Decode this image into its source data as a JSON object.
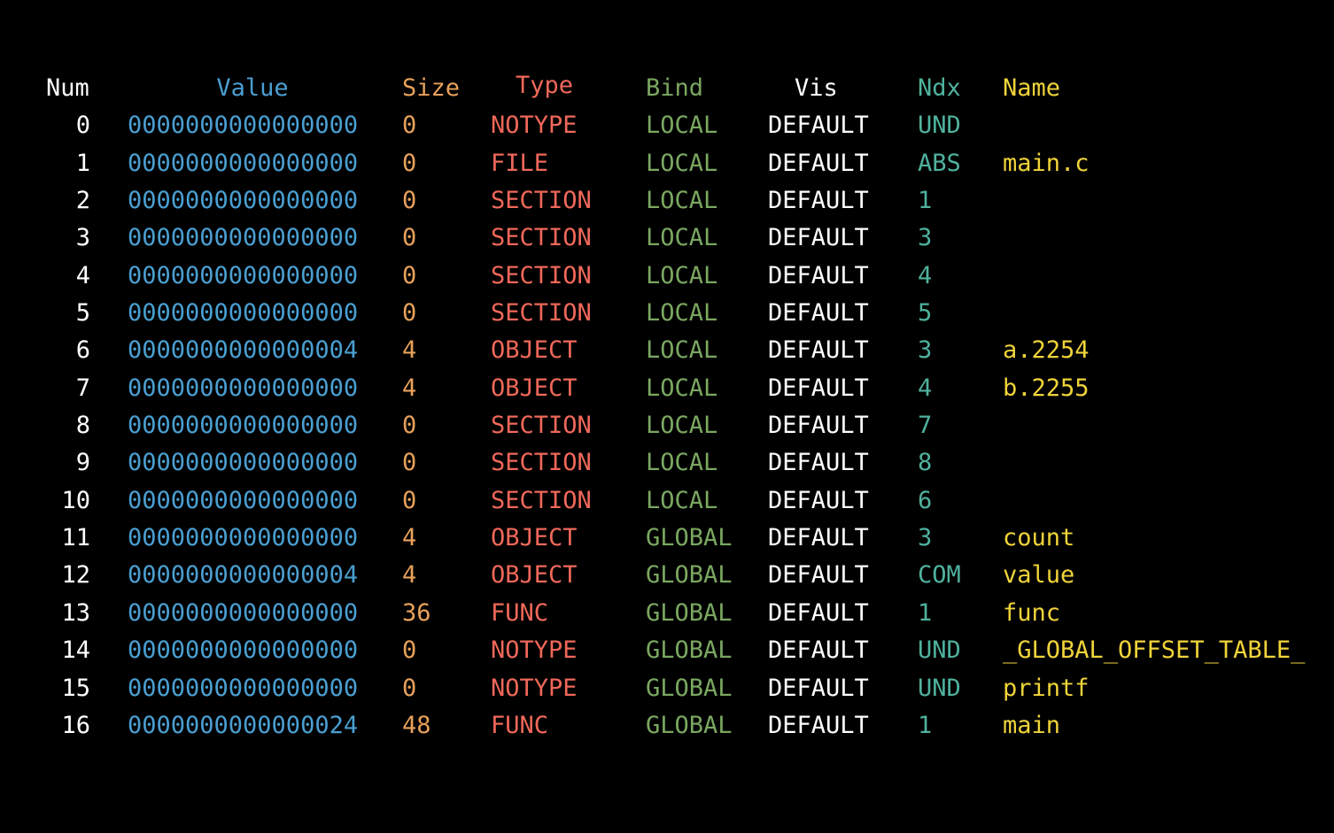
{
  "colors": {
    "background": "#000000",
    "num": "#ffffff",
    "value": "#4a9fd1",
    "size": "#e8a15a",
    "type": "#f0685a",
    "bind": "#7aa760",
    "vis": "#ffffff",
    "ndx": "#4fb29e",
    "name": "#f0d43a"
  },
  "headers": {
    "num": "Num",
    "value": "Value",
    "size": "Size",
    "type": "Type",
    "bind": "Bind",
    "vis": "Vis",
    "ndx": "Ndx",
    "name": "Name"
  },
  "rows": [
    {
      "num": "0",
      "value": "0000000000000000",
      "size": "0",
      "type": "NOTYPE",
      "bind": "LOCAL",
      "vis": "DEFAULT",
      "ndx": "UND",
      "name": ""
    },
    {
      "num": "1",
      "value": "0000000000000000",
      "size": "0",
      "type": "FILE",
      "bind": "LOCAL",
      "vis": "DEFAULT",
      "ndx": "ABS",
      "name": "main.c"
    },
    {
      "num": "2",
      "value": "0000000000000000",
      "size": "0",
      "type": "SECTION",
      "bind": "LOCAL",
      "vis": "DEFAULT",
      "ndx": "1",
      "name": ""
    },
    {
      "num": "3",
      "value": "0000000000000000",
      "size": "0",
      "type": "SECTION",
      "bind": "LOCAL",
      "vis": "DEFAULT",
      "ndx": "3",
      "name": ""
    },
    {
      "num": "4",
      "value": "0000000000000000",
      "size": "0",
      "type": "SECTION",
      "bind": "LOCAL",
      "vis": "DEFAULT",
      "ndx": "4",
      "name": ""
    },
    {
      "num": "5",
      "value": "0000000000000000",
      "size": "0",
      "type": "SECTION",
      "bind": "LOCAL",
      "vis": "DEFAULT",
      "ndx": "5",
      "name": ""
    },
    {
      "num": "6",
      "value": "0000000000000004",
      "size": "4",
      "type": "OBJECT",
      "bind": "LOCAL",
      "vis": "DEFAULT",
      "ndx": "3",
      "name": "a.2254"
    },
    {
      "num": "7",
      "value": "0000000000000000",
      "size": "4",
      "type": "OBJECT",
      "bind": "LOCAL",
      "vis": "DEFAULT",
      "ndx": "4",
      "name": "b.2255"
    },
    {
      "num": "8",
      "value": "0000000000000000",
      "size": "0",
      "type": "SECTION",
      "bind": "LOCAL",
      "vis": "DEFAULT",
      "ndx": "7",
      "name": ""
    },
    {
      "num": "9",
      "value": "0000000000000000",
      "size": "0",
      "type": "SECTION",
      "bind": "LOCAL",
      "vis": "DEFAULT",
      "ndx": "8",
      "name": ""
    },
    {
      "num": "10",
      "value": "0000000000000000",
      "size": "0",
      "type": "SECTION",
      "bind": "LOCAL",
      "vis": "DEFAULT",
      "ndx": "6",
      "name": ""
    },
    {
      "num": "11",
      "value": "0000000000000000",
      "size": "4",
      "type": "OBJECT",
      "bind": "GLOBAL",
      "vis": "DEFAULT",
      "ndx": "3",
      "name": "count"
    },
    {
      "num": "12",
      "value": "0000000000000004",
      "size": "4",
      "type": "OBJECT",
      "bind": "GLOBAL",
      "vis": "DEFAULT",
      "ndx": "COM",
      "name": "value"
    },
    {
      "num": "13",
      "value": "0000000000000000",
      "size": "36",
      "type": "FUNC",
      "bind": "GLOBAL",
      "vis": "DEFAULT",
      "ndx": "1",
      "name": "func"
    },
    {
      "num": "14",
      "value": "0000000000000000",
      "size": "0",
      "type": "NOTYPE",
      "bind": "GLOBAL",
      "vis": "DEFAULT",
      "ndx": "UND",
      "name": "_GLOBAL_OFFSET_TABLE_"
    },
    {
      "num": "15",
      "value": "0000000000000000",
      "size": "0",
      "type": "NOTYPE",
      "bind": "GLOBAL",
      "vis": "DEFAULT",
      "ndx": "UND",
      "name": "printf"
    },
    {
      "num": "16",
      "value": "0000000000000024",
      "size": "48",
      "type": "FUNC",
      "bind": "GLOBAL",
      "vis": "DEFAULT",
      "ndx": "1",
      "name": "main"
    }
  ]
}
